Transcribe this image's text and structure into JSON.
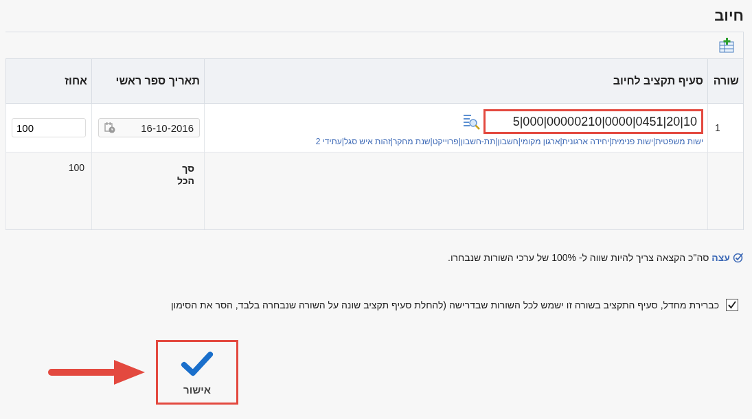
{
  "title": "חיוב",
  "table": {
    "columns": [
      "שורה",
      "סעיף תקציב לחיוב",
      "תאריך ספר ראשי",
      "אחוז"
    ],
    "rows": [
      {
        "line": "1",
        "budget_account": "5|000|00000210|0000|0451|20|10",
        "highlighted": true,
        "segments": "ישות משפטית|ישות פנימית|יחידה ארגונית|ארגון מקומי|חשבון|תת-חשבון|פרוייקט|שנת מחקר|זהות איש סגל|עתידי 2",
        "gl_date": "16-10-2016",
        "percent": "100"
      }
    ],
    "total": {
      "label": "סך הכל",
      "value": "100"
    }
  },
  "tip": {
    "label": "עצה",
    "text": "סה\"כ הקצאה צריך להיות שווה ל- 100% של ערכי השורות שנבחרו."
  },
  "default_option": {
    "checked": true,
    "label": "כברירת מחדל, סעיף התקציב בשורה זו ישמש לכל השורות שבדרישה (להחלת סעיף תקציב שונה על השורה שנבחרה בלבד, הסר את הסימון"
  },
  "confirm_button": {
    "label": "אישור",
    "highlighted": true
  }
}
